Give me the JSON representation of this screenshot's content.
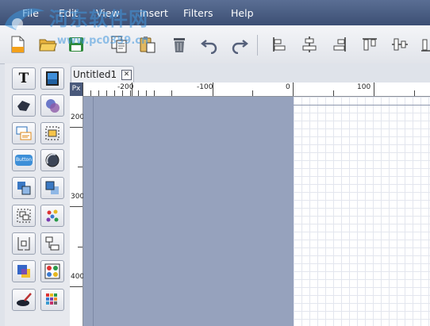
{
  "menubar": {
    "items": [
      "File",
      "Edit",
      "View",
      "Insert",
      "Filters",
      "Help"
    ]
  },
  "watermark": {
    "title": "河东软件网",
    "url": "www.pc0359.cn"
  },
  "toolbar": {
    "buttons": [
      {
        "name": "new-document",
        "icon": "new-file-icon"
      },
      {
        "name": "open",
        "icon": "folder-open-icon"
      },
      {
        "name": "save",
        "icon": "floppy-disk-icon"
      },
      {
        "name": "copy",
        "icon": "copy-icon"
      },
      {
        "name": "paste",
        "icon": "paste-icon"
      },
      {
        "name": "delete",
        "icon": "trash-icon"
      },
      {
        "name": "undo",
        "icon": "undo-icon"
      },
      {
        "name": "redo",
        "icon": "redo-icon"
      },
      {
        "name": "align-left",
        "icon": "align-left-icon"
      },
      {
        "name": "align-center",
        "icon": "align-center-icon"
      },
      {
        "name": "align-right",
        "icon": "align-right-icon"
      },
      {
        "name": "align-top",
        "icon": "align-top-icon"
      },
      {
        "name": "align-middle",
        "icon": "align-middle-icon"
      },
      {
        "name": "align-bottom",
        "icon": "align-bottom-icon"
      }
    ]
  },
  "palette": {
    "tools": [
      "text-tool-icon",
      "image-tool-icon",
      "shape-tool-icon",
      "ellipse-group-icon",
      "textbox-tool-icon",
      "selection-frame-icon",
      "button-tool-icon",
      "circle-tool-icon",
      "send-backward-icon",
      "bring-forward-icon",
      "group-icon",
      "scatter-dots-icon",
      "layout-left-icon",
      "layout-tree-icon",
      "color-squares-icon",
      "color-palette-icon",
      "brush-tool-icon",
      "color-grid-icon"
    ],
    "text_tool_glyph": "T",
    "button_tool_label": "Button"
  },
  "document": {
    "tab_title": "Untitled1",
    "close_glyph": "✕"
  },
  "ruler": {
    "unit": "Px",
    "h_labels": [
      "-200",
      "-100",
      "0",
      "100"
    ],
    "v_labels": [
      "200",
      "300",
      "400"
    ]
  },
  "colors": {
    "menubar": "#3f5178",
    "pasteboard": "#96a2bd",
    "page": "#ffffff",
    "grid": "#e3e6ee"
  }
}
